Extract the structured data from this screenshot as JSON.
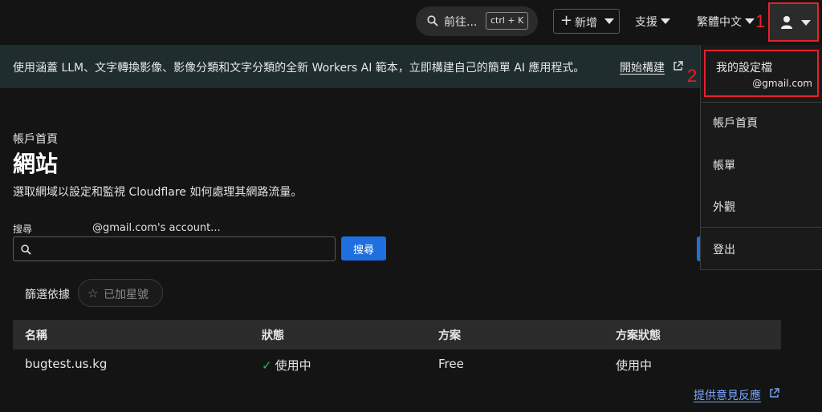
{
  "topbar": {
    "goto_label": "前往...",
    "goto_shortcut": "ctrl + K",
    "add_label": "新增",
    "support_label": "支援",
    "language_label": "繁體中文"
  },
  "annotations": {
    "mark1": "1",
    "mark2": "2"
  },
  "banner": {
    "text": "使用涵蓋 LLM、文字轉換影像、影像分類和文字分類的全新 Workers AI 範本，立即構建自己的簡單 AI 應用程式。",
    "link_label": "開始構建"
  },
  "page": {
    "breadcrumb": "帳戶首頁",
    "title": "網站",
    "description": "選取網域以設定和監視 Cloudflare 如何處理其網路流量。"
  },
  "search": {
    "label": "搜尋",
    "account_label": "@gmail.com's account...",
    "placeholder": "",
    "button_label": "搜尋"
  },
  "filter": {
    "label": "篩選依據",
    "starred_label": "已加星號"
  },
  "table": {
    "headers": [
      "名稱",
      "狀態",
      "方案",
      "方案狀態"
    ],
    "rows": [
      {
        "name": "bugtest.us.kg",
        "status": "使用中",
        "plan": "Free",
        "plan_status": "使用中"
      }
    ]
  },
  "feedback_label": "提供意見反應",
  "user_menu": {
    "profile_title": "我的設定檔",
    "profile_email": "@gmail.com",
    "items": [
      "帳戶首頁",
      "帳單",
      "外觀",
      "登出"
    ]
  },
  "colors": {
    "background": "#141414",
    "banner": "#1f2d2e",
    "accent_blue": "#1f6fe0",
    "highlight_red": "#e8202a",
    "status_green": "#2fb45a"
  }
}
